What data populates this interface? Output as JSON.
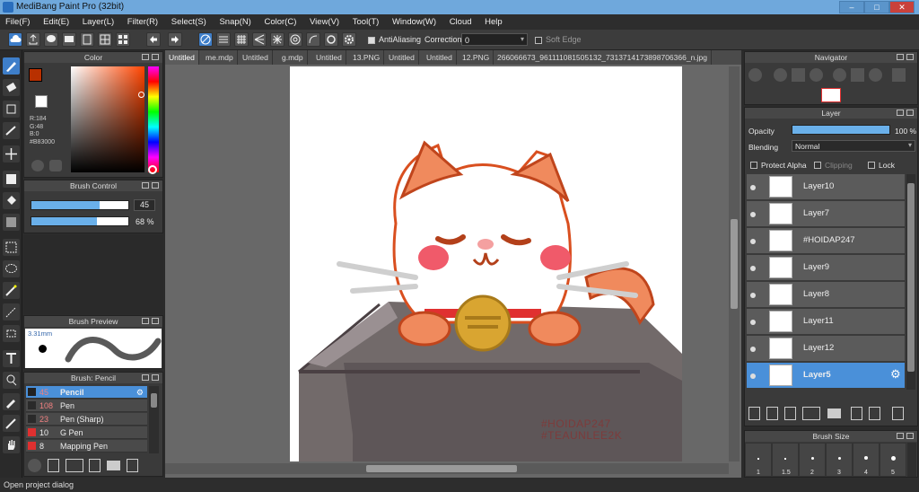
{
  "window": {
    "title": "MediBang Paint Pro (32bit)"
  },
  "menu": [
    "File(F)",
    "Edit(E)",
    "Layer(L)",
    "Filter(R)",
    "Select(S)",
    "Snap(N)",
    "Color(C)",
    "View(V)",
    "Tool(T)",
    "Window(W)",
    "Cloud",
    "Help"
  ],
  "toolbar": {
    "antialiasing_label": "AntiAliasing",
    "correction_label": "Correction",
    "correction_value": "0",
    "softedge_label": "Soft Edge"
  },
  "color_panel": {
    "title": "Color",
    "r": "R:184",
    "g": "G:48",
    "b": "B:0",
    "hex": "#B83000",
    "color": "#B83000"
  },
  "brush_control": {
    "title": "Brush Control",
    "size_value": "45",
    "opacity_value": "68 %",
    "size_fraction": 0.7,
    "opacity_fraction": 0.68
  },
  "brush_preview": {
    "title": "Brush Preview",
    "size": "3.31mm"
  },
  "brush_list": {
    "title": "Brush: Pencil",
    "items": [
      {
        "size": "45",
        "name": "Pencil",
        "color": "#000000"
      },
      {
        "size": "108",
        "name": "Pen",
        "color": "#2a2a2a"
      },
      {
        "size": "23",
        "name": "Pen (Sharp)",
        "color": "#2a2a2a"
      },
      {
        "size": "10",
        "name": "G Pen",
        "color": "#e03030"
      },
      {
        "size": "8",
        "name": "Mapping Pen",
        "color": "#e03030"
      }
    ]
  },
  "tabs": [
    "Untitled",
    "me.mdp",
    "Untitled",
    "g.mdp",
    "Untitled",
    "13.PNG",
    "Untitled",
    "Untitled",
    "12.PNG",
    "266066673_961111081505132_7313714173898706366_n.jpg"
  ],
  "artwork": {
    "hashtag1": "#HOIDAP247",
    "hashtag2": "#TEAUNLEE2K"
  },
  "navigator": {
    "title": "Navigator"
  },
  "layer_panel": {
    "title": "Layer",
    "opacity_label": "Opacity",
    "opacity_value": "100 %",
    "opacity_fraction": 1.0,
    "blending_label": "Blending",
    "blending_value": "Normal",
    "protect_alpha": "Protect Alpha",
    "clipping": "Clipping",
    "lock": "Lock",
    "layers": [
      "Layer10",
      "Layer7",
      "#HOIDAP247",
      "Layer9",
      "Layer8",
      "Layer11",
      "Layer12",
      "Layer5"
    ]
  },
  "brush_size_panel": {
    "title": "Brush Size",
    "sizes": [
      "1",
      "1.5",
      "2",
      "3",
      "4",
      "5"
    ]
  },
  "status": {
    "text": "Open project dialog"
  }
}
